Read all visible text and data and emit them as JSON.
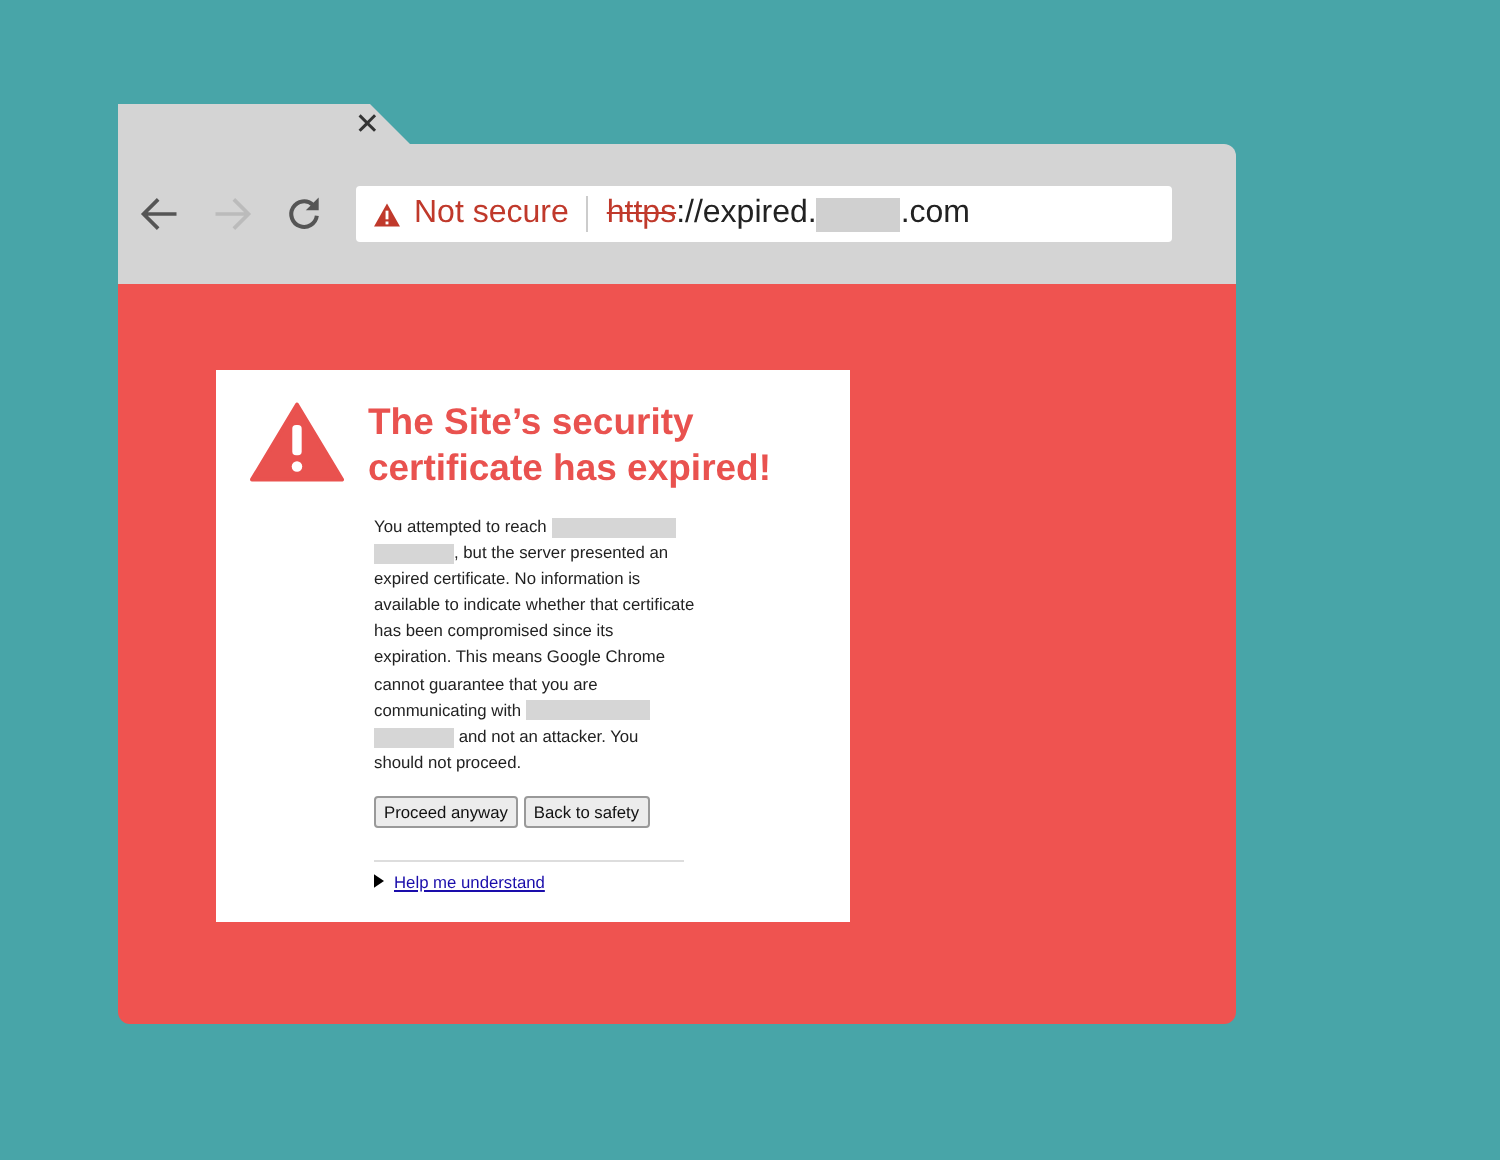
{
  "tab": {
    "close_glyph": "✕"
  },
  "toolbar": {
    "back_enabled": true,
    "forward_enabled": false
  },
  "address_bar": {
    "security_label": "Not secure",
    "url": [
      {
        "kind": "struck",
        "text": "https"
      },
      {
        "kind": "text",
        "text": "://expired."
      },
      {
        "kind": "redacted"
      },
      {
        "kind": "text",
        "text": ".com"
      }
    ]
  },
  "warning": {
    "title": "The Site’s security certificate has expired!",
    "lines": [
      [
        {
          "kind": "text",
          "text": "You attempted to reach "
        },
        {
          "kind": "redacted"
        }
      ],
      [
        {
          "kind": "redacted"
        },
        {
          "kind": "text",
          "text": ", but the server presented an"
        }
      ],
      [
        {
          "kind": "text",
          "text": "expired certificate. No information is"
        }
      ],
      [
        {
          "kind": "text",
          "text": "available to indicate whether that certificate"
        }
      ],
      [
        {
          "kind": "text",
          "text": "has been compromised since its"
        }
      ],
      [
        {
          "kind": "text",
          "text": "expiration. This means Google Chrome"
        }
      ],
      [
        {
          "kind": "text",
          "text": "cannot guarantee that you are"
        }
      ],
      [
        {
          "kind": "text",
          "text": "communicating with "
        },
        {
          "kind": "redacted"
        }
      ],
      [
        {
          "kind": "redacted"
        },
        {
          "kind": "text",
          "text": " and not an attacker. You"
        }
      ],
      [
        {
          "kind": "text",
          "text": "should not proceed."
        }
      ]
    ],
    "buttons": [
      "Proceed anyway",
      "Back to safety"
    ],
    "help_link": "Help me understand"
  }
}
